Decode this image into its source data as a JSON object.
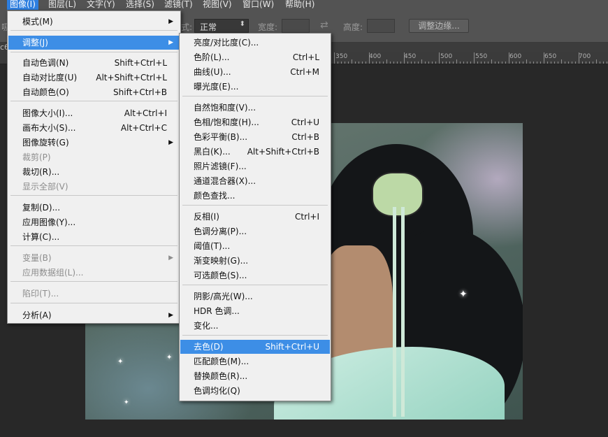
{
  "menubar": {
    "items": [
      "图像(I)",
      "图层(L)",
      "文字(Y)",
      "选择(S)",
      "滤镜(T)",
      "视图(V)",
      "窗口(W)",
      "帮助(H)"
    ]
  },
  "optbar": {
    "left_partial": "吸",
    "style_label_partial": "式:",
    "style_value": "正常",
    "width_label": "宽度:",
    "height_label": "高度:",
    "refine_button": "调整边缘..."
  },
  "tab": {
    "partial": "c6"
  },
  "ruler": {
    "labels": [
      "350",
      "400",
      "450",
      "500",
      "550",
      "600",
      "650",
      "700"
    ]
  },
  "image_menu": {
    "items": [
      {
        "label": "模式(M)",
        "shortcut": "",
        "submenu": true,
        "state": "normal"
      },
      {
        "label": "调整(J)",
        "shortcut": "",
        "submenu": true,
        "state": "highlighted"
      },
      {
        "label": "自动色调(N)",
        "shortcut": "Shift+Ctrl+L",
        "submenu": false,
        "state": "normal"
      },
      {
        "label": "自动对比度(U)",
        "shortcut": "Alt+Shift+Ctrl+L",
        "submenu": false,
        "state": "normal"
      },
      {
        "label": "自动颜色(O)",
        "shortcut": "Shift+Ctrl+B",
        "submenu": false,
        "state": "normal"
      },
      {
        "label": "图像大小(I)...",
        "shortcut": "Alt+Ctrl+I",
        "submenu": false,
        "state": "normal"
      },
      {
        "label": "画布大小(S)...",
        "shortcut": "Alt+Ctrl+C",
        "submenu": false,
        "state": "normal"
      },
      {
        "label": "图像旋转(G)",
        "shortcut": "",
        "submenu": true,
        "state": "normal"
      },
      {
        "label": "裁剪(P)",
        "shortcut": "",
        "submenu": false,
        "state": "disabled"
      },
      {
        "label": "裁切(R)...",
        "shortcut": "",
        "submenu": false,
        "state": "normal"
      },
      {
        "label": "显示全部(V)",
        "shortcut": "",
        "submenu": false,
        "state": "disabled"
      },
      {
        "label": "复制(D)...",
        "shortcut": "",
        "submenu": false,
        "state": "normal"
      },
      {
        "label": "应用图像(Y)...",
        "shortcut": "",
        "submenu": false,
        "state": "normal"
      },
      {
        "label": "计算(C)...",
        "shortcut": "",
        "submenu": false,
        "state": "normal"
      },
      {
        "label": "变量(B)",
        "shortcut": "",
        "submenu": true,
        "state": "disabled"
      },
      {
        "label": "应用数据组(L)...",
        "shortcut": "",
        "submenu": false,
        "state": "disabled"
      },
      {
        "label": "陷印(T)...",
        "shortcut": "",
        "submenu": false,
        "state": "disabled"
      },
      {
        "label": "分析(A)",
        "shortcut": "",
        "submenu": true,
        "state": "normal"
      }
    ]
  },
  "adjust_menu": {
    "items": [
      {
        "label": "亮度/对比度(C)...",
        "shortcut": "",
        "state": "normal"
      },
      {
        "label": "色阶(L)...",
        "shortcut": "Ctrl+L",
        "state": "normal"
      },
      {
        "label": "曲线(U)...",
        "shortcut": "Ctrl+M",
        "state": "normal"
      },
      {
        "label": "曝光度(E)...",
        "shortcut": "",
        "state": "normal"
      },
      {
        "label": "自然饱和度(V)...",
        "shortcut": "",
        "state": "normal"
      },
      {
        "label": "色相/饱和度(H)...",
        "shortcut": "Ctrl+U",
        "state": "normal"
      },
      {
        "label": "色彩平衡(B)...",
        "shortcut": "Ctrl+B",
        "state": "normal"
      },
      {
        "label": "黑白(K)...",
        "shortcut": "Alt+Shift+Ctrl+B",
        "state": "normal"
      },
      {
        "label": "照片滤镜(F)...",
        "shortcut": "",
        "state": "normal"
      },
      {
        "label": "通道混合器(X)...",
        "shortcut": "",
        "state": "normal"
      },
      {
        "label": "颜色查找...",
        "shortcut": "",
        "state": "normal"
      },
      {
        "label": "反相(I)",
        "shortcut": "Ctrl+I",
        "state": "normal"
      },
      {
        "label": "色调分离(P)...",
        "shortcut": "",
        "state": "normal"
      },
      {
        "label": "阈值(T)...",
        "shortcut": "",
        "state": "normal"
      },
      {
        "label": "渐变映射(G)...",
        "shortcut": "",
        "state": "normal"
      },
      {
        "label": "可选颜色(S)...",
        "shortcut": "",
        "state": "normal"
      },
      {
        "label": "阴影/高光(W)...",
        "shortcut": "",
        "state": "normal"
      },
      {
        "label": "HDR 色调...",
        "shortcut": "",
        "state": "normal"
      },
      {
        "label": "变化...",
        "shortcut": "",
        "state": "normal"
      },
      {
        "label": "去色(D)",
        "shortcut": "Shift+Ctrl+U",
        "state": "highlighted"
      },
      {
        "label": "匹配颜色(M)...",
        "shortcut": "",
        "state": "normal"
      },
      {
        "label": "替换颜色(R)...",
        "shortcut": "",
        "state": "normal"
      },
      {
        "label": "色调均化(Q)",
        "shortcut": "",
        "state": "normal"
      }
    ]
  },
  "colors": {
    "highlight": "#3d8ee6",
    "ui_bg": "#535353",
    "workspace": "#282828"
  }
}
